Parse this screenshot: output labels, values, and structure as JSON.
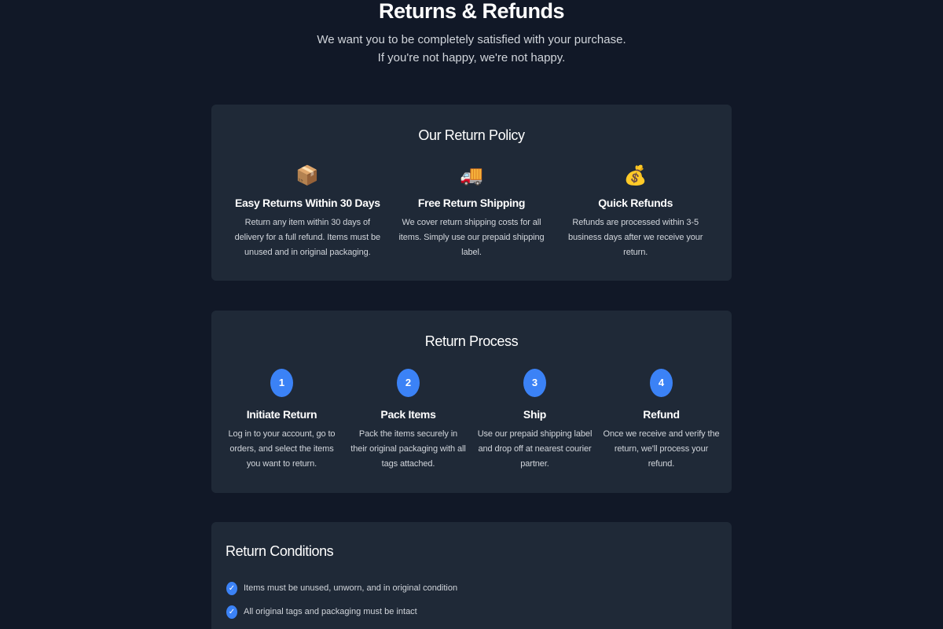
{
  "hero": {
    "title": "Returns & Refunds",
    "subtitle": "We want you to be completely satisfied with your purchase. If you're not happy, we're not happy."
  },
  "policy": {
    "title": "Our Return Policy",
    "items": [
      {
        "icon": "package-icon",
        "emoji": "📦",
        "title": "Easy Returns Within 30 Days",
        "text": "Return any item within 30 days of delivery for a full refund. Items must be unused and in original packaging."
      },
      {
        "icon": "delivery-truck-icon",
        "emoji": "🚚",
        "title": "Free Return Shipping",
        "text": "We cover return shipping costs for all items. Simply use our prepaid shipping label."
      },
      {
        "icon": "money-bag-icon",
        "emoji": "💰",
        "title": "Quick Refunds",
        "text": "Refunds are processed within 3-5 business days after we receive your return."
      }
    ]
  },
  "process": {
    "title": "Return Process",
    "steps": [
      {
        "num": "1",
        "title": "Initiate Return",
        "text": "Log in to your account, go to orders, and select the items you want to return."
      },
      {
        "num": "2",
        "title": "Pack Items",
        "text": "Pack the items securely in their original packaging with all tags attached."
      },
      {
        "num": "3",
        "title": "Ship",
        "text": "Use our prepaid shipping label and drop off at nearest courier partner."
      },
      {
        "num": "4",
        "title": "Refund",
        "text": "Once we receive and verify the return, we'll process your refund."
      }
    ]
  },
  "conditions": {
    "title": "Return Conditions",
    "items": [
      "Items must be unused, unworn, and in original condition",
      "All original tags and packaging must be intact"
    ],
    "check_glyph": "✓"
  },
  "colors": {
    "background": "#111827",
    "card": "#1f2937",
    "accent": "#3b82f6"
  }
}
